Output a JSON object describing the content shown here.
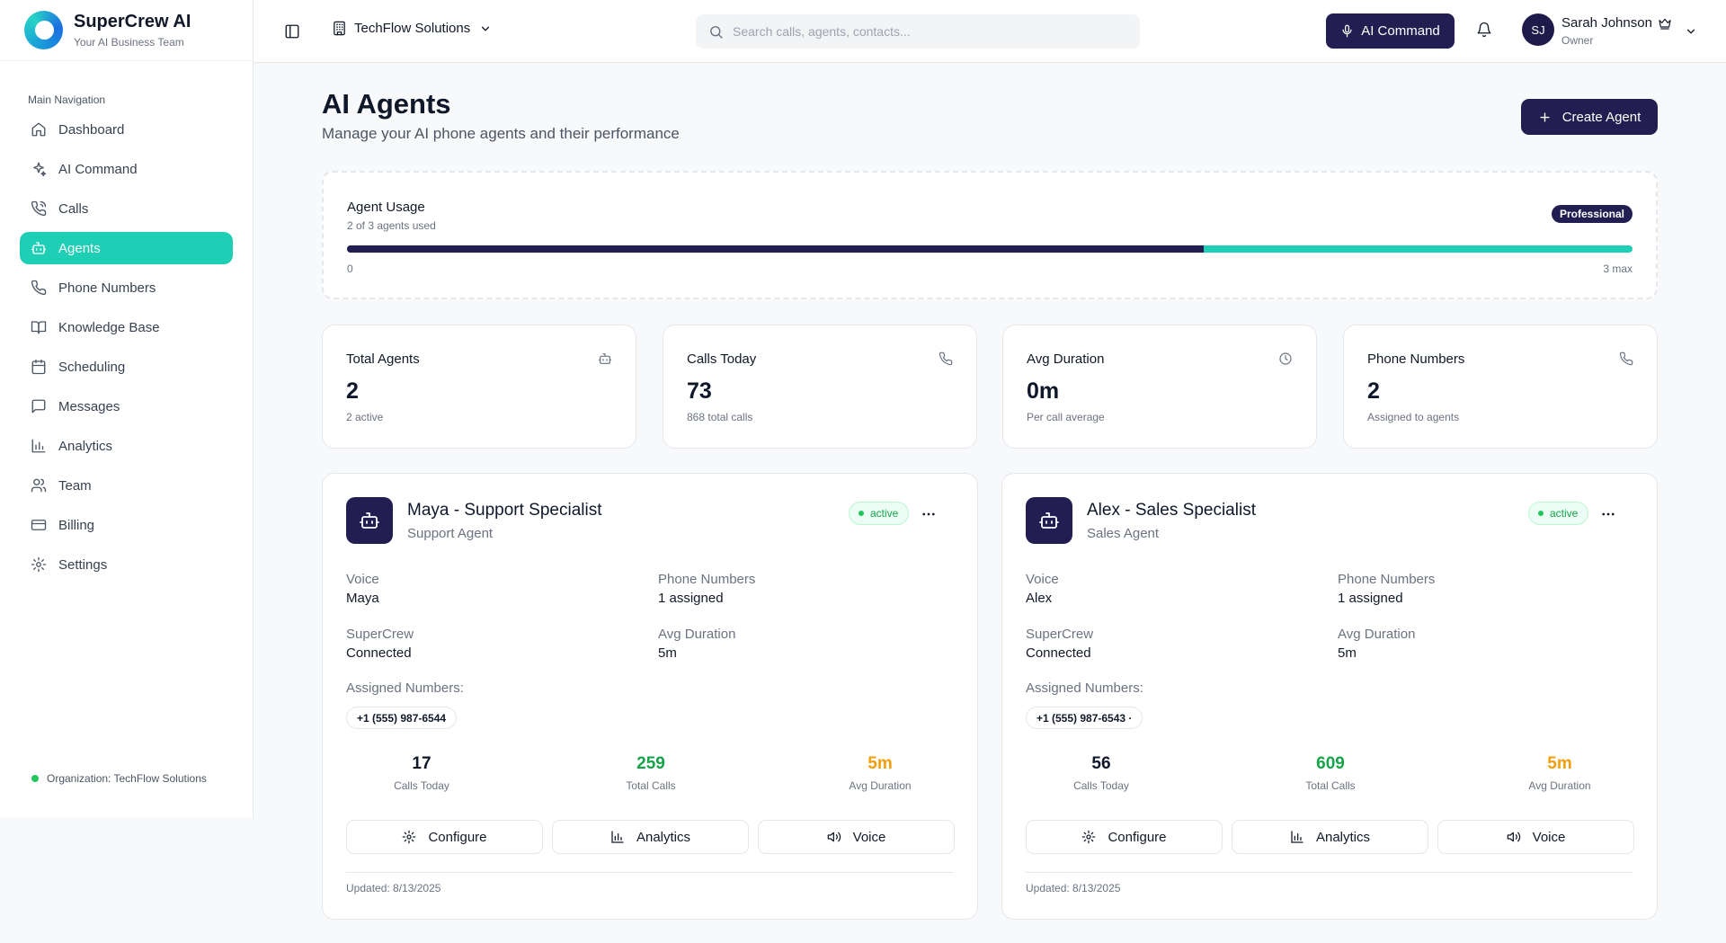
{
  "brand": {
    "title": "SuperCrew AI",
    "subtitle": "Your AI Business Team"
  },
  "sidebar": {
    "header": "Main Navigation",
    "items": [
      {
        "label": "Dashboard",
        "icon": "home-icon"
      },
      {
        "label": "AI Command",
        "icon": "sparkle-icon"
      },
      {
        "label": "Calls",
        "icon": "phone-call-icon"
      },
      {
        "label": "Agents",
        "icon": "bot-icon",
        "active": true
      },
      {
        "label": "Phone Numbers",
        "icon": "phone-icon"
      },
      {
        "label": "Knowledge Base",
        "icon": "book-icon"
      },
      {
        "label": "Scheduling",
        "icon": "calendar-icon"
      },
      {
        "label": "Messages",
        "icon": "message-icon"
      },
      {
        "label": "Analytics",
        "icon": "bar-chart-icon"
      },
      {
        "label": "Team",
        "icon": "users-icon"
      },
      {
        "label": "Billing",
        "icon": "credit-card-icon"
      },
      {
        "label": "Settings",
        "icon": "gear-icon"
      }
    ],
    "organization": "Organization: TechFlow Solutions"
  },
  "topbar": {
    "company": "TechFlow Solutions",
    "search_placeholder": "Search calls, agents, contacts...",
    "ai_command_label": "AI Command",
    "user": {
      "name": "Sarah Johnson",
      "role": "Owner",
      "initials": "SJ"
    }
  },
  "page": {
    "title": "AI Agents",
    "subtitle": "Manage your AI phone agents and their performance",
    "create_label": "Create Agent"
  },
  "usage": {
    "title": "Agent Usage",
    "subtitle": "2 of 3 agents used",
    "plan": "Professional",
    "used": 2,
    "max": 3,
    "min_label": "0",
    "max_label": "3 max"
  },
  "stats": [
    {
      "title": "Total Agents",
      "value": "2",
      "sub": "2 active",
      "icon": "bot-icon"
    },
    {
      "title": "Calls Today",
      "value": "73",
      "sub": "868 total calls",
      "icon": "phone-icon"
    },
    {
      "title": "Avg Duration",
      "value": "0m",
      "sub": "Per call average",
      "icon": "clock-icon"
    },
    {
      "title": "Phone Numbers",
      "value": "2",
      "sub": "Assigned to agents",
      "icon": "phone-icon"
    }
  ],
  "agents": [
    {
      "name": "Maya - Support Specialist",
      "type": "Support Agent",
      "status": "active",
      "voice_label": "Voice",
      "voice": "Maya",
      "phone_label": "Phone Numbers",
      "phone": "1 assigned",
      "supercrew_label": "SuperCrew",
      "supercrew": "Connected",
      "avg_label": "Avg Duration",
      "avg": "5m",
      "assigned_label": "Assigned Numbers:",
      "number": "+1 (555) 987-6544",
      "metrics": [
        {
          "value": "17",
          "label": "Calls Today",
          "color": "#0f172a"
        },
        {
          "value": "259",
          "label": "Total Calls",
          "color": "#16a34a"
        },
        {
          "value": "5m",
          "label": "Avg Duration",
          "color": "#f59e0b"
        }
      ],
      "actions": {
        "configure": "Configure",
        "analytics": "Analytics",
        "voice": "Voice"
      },
      "updated": "Updated: 8/13/2025"
    },
    {
      "name": "Alex - Sales Specialist",
      "type": "Sales Agent",
      "status": "active",
      "voice_label": "Voice",
      "voice": "Alex",
      "phone_label": "Phone Numbers",
      "phone": "1 assigned",
      "supercrew_label": "SuperCrew",
      "supercrew": "Connected",
      "avg_label": "Avg Duration",
      "avg": "5m",
      "assigned_label": "Assigned Numbers:",
      "number": "+1 (555) 987-6543 ·",
      "metrics": [
        {
          "value": "56",
          "label": "Calls Today",
          "color": "#0f172a"
        },
        {
          "value": "609",
          "label": "Total Calls",
          "color": "#16a34a"
        },
        {
          "value": "5m",
          "label": "Avg Duration",
          "color": "#f59e0b"
        }
      ],
      "actions": {
        "configure": "Configure",
        "analytics": "Analytics",
        "voice": "Voice"
      },
      "updated": "Updated: 8/13/2025"
    }
  ],
  "colors": {
    "primary": "#231e52",
    "accent": "#1fcfb5",
    "success": "#16a34a",
    "warning": "#f59e0b"
  }
}
